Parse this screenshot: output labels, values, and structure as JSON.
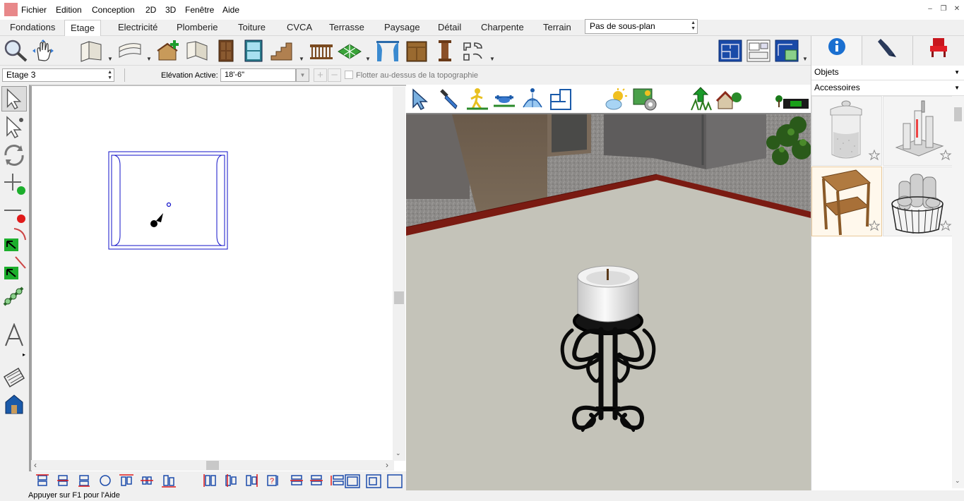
{
  "menu": [
    "Fichier",
    "Edition",
    "Conception",
    "2D",
    "3D",
    "Fenêtre",
    "Aide"
  ],
  "tabs": [
    "Fondations",
    "Etage",
    "Electricité",
    "Plomberie",
    "Toiture",
    "CVCA",
    "Terrasse",
    "Paysage",
    "Détail",
    "Charpente",
    "Terrain"
  ],
  "active_tab": "Etage",
  "subplan": {
    "value": "Pas de sous-plan"
  },
  "options": {
    "floor": "Etage 3",
    "elevation_label": "Elévation Active:",
    "elevation_value": "18'-6\"",
    "topo_label": "Flotter au-dessus de la topographie",
    "topo_checked": false
  },
  "library": {
    "category": "Objets",
    "subcategory": "Accessoires",
    "items": [
      "sugar-jar",
      "candle-set",
      "corner-shelf",
      "towel-basket"
    ]
  },
  "status": "Appuyer sur F1 pour l'Aide",
  "colors": {
    "accent": "#1a6fd0",
    "plan_lines": "#1010c8",
    "wall": "#7a1b12"
  }
}
